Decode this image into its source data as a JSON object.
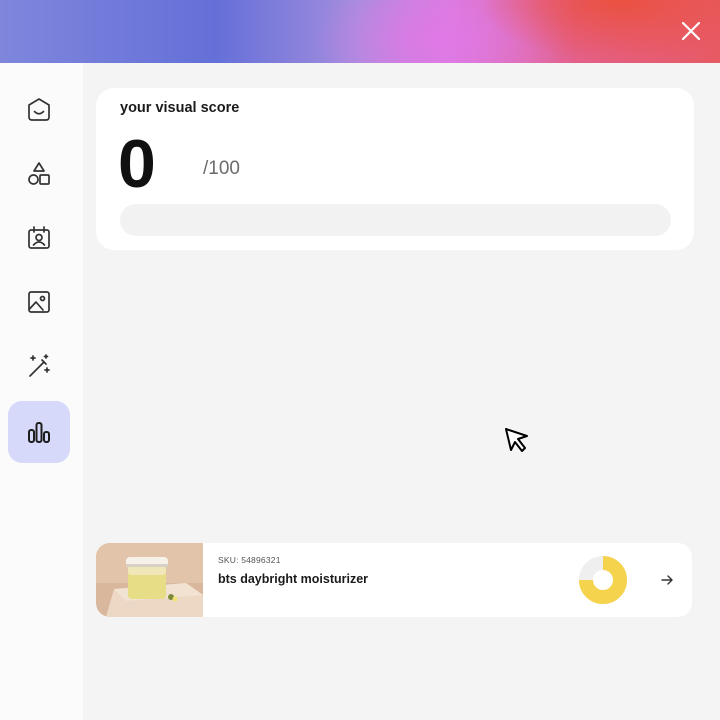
{
  "colors": {
    "accent": "#6470d8",
    "active_nav_bg": "#d6d9fa",
    "donut_fill": "#f6d34d",
    "donut_track": "#efefef"
  },
  "header": {
    "close_icon": "close-icon"
  },
  "sidebar": {
    "items": [
      {
        "icon": "smile-box-icon",
        "active": false
      },
      {
        "icon": "shapes-icon",
        "active": false
      },
      {
        "icon": "contact-card-icon",
        "active": false
      },
      {
        "icon": "image-icon",
        "active": false
      },
      {
        "icon": "magic-wand-icon",
        "active": false
      },
      {
        "icon": "bar-chart-icon",
        "active": true
      }
    ]
  },
  "score": {
    "title": "your visual score",
    "value": "0",
    "max_label": "/100",
    "progress_percent": 0
  },
  "product": {
    "sku": "SKU: 54896321",
    "name": "bts daybright moisturizer",
    "donut_fraction": 0.75,
    "arrow_icon": "arrow-right-icon"
  }
}
